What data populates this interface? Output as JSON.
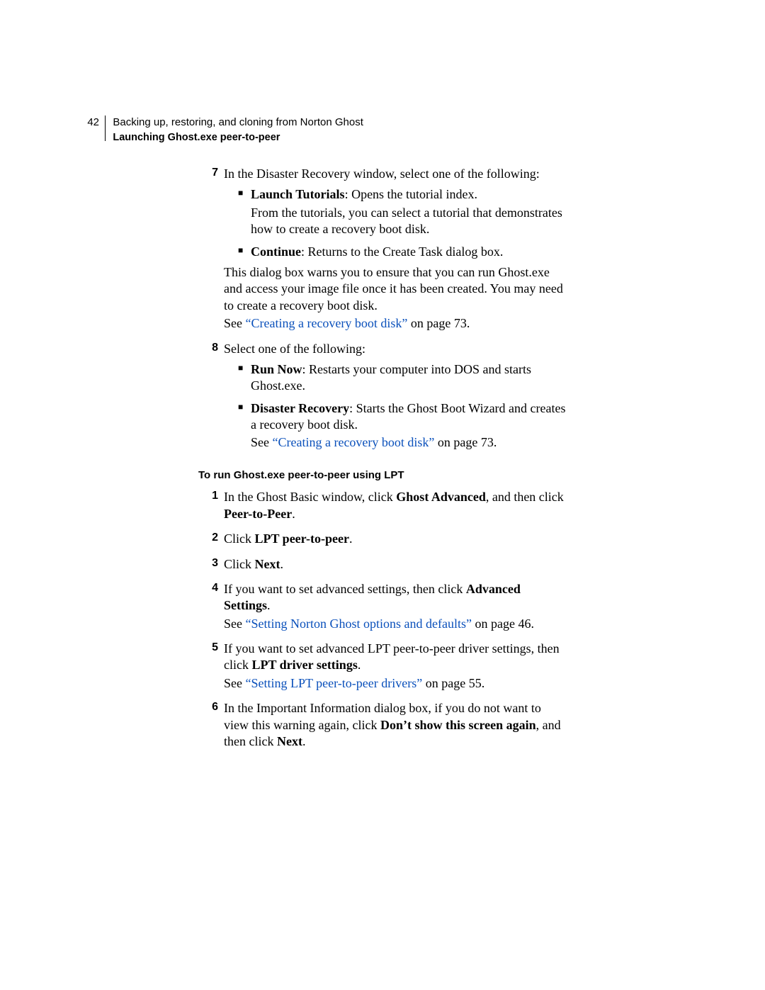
{
  "header": {
    "page_number": "42",
    "chapter": "Backing up, restoring, and cloning from Norton Ghost",
    "section": "Launching Ghost.exe peer-to-peer"
  },
  "step7": {
    "num": "7",
    "intro": "In the Disaster Recovery window, select one of the following:",
    "b1_bold": "Launch Tutorials",
    "b1_rest": ": Opens the tutorial index.",
    "b1_cont": "From the tutorials, you can select a tutorial that demonstrates how to create a recovery boot disk.",
    "b2_bold": "Continue",
    "b2_rest": ": Returns to the Create Task dialog box.",
    "after1": "This dialog box warns you to ensure that you can run Ghost.exe and access your image file once it has been created. You may need to create a recovery boot disk.",
    "see_pre": "See ",
    "see_link": "“Creating a recovery boot disk”",
    "see_post": " on page 73."
  },
  "step8": {
    "num": "8",
    "intro": "Select one of the following:",
    "b1_bold": "Run Now",
    "b1_rest": ": Restarts your computer into DOS and starts Ghost.exe.",
    "b2_bold": "Disaster Recovery",
    "b2_rest": ": Starts the Ghost Boot Wizard and creates a recovery boot disk.",
    "b2_see_pre": "See ",
    "b2_see_link": "“Creating a recovery boot disk”",
    "b2_see_post": " on page 73."
  },
  "heading2": "To run Ghost.exe peer-to-peer using LPT",
  "lpt1": {
    "num": "1",
    "pre": "In the Ghost Basic window, click ",
    "b1": "Ghost Advanced",
    "mid": ", and then click ",
    "b2": "Peer-to-Peer",
    "post": "."
  },
  "lpt2": {
    "num": "2",
    "pre": "Click ",
    "b1": "LPT peer-to-peer",
    "post": "."
  },
  "lpt3": {
    "num": "3",
    "pre": "Click ",
    "b1": "Next",
    "post": "."
  },
  "lpt4": {
    "num": "4",
    "pre": "If you want to set advanced settings, then click ",
    "b1": "Advanced Settings",
    "post": ".",
    "see_pre": "See ",
    "see_link": "“Setting Norton Ghost options and defaults”",
    "see_post": " on page 46."
  },
  "lpt5": {
    "num": "5",
    "pre": "If you want to set advanced LPT peer-to-peer driver settings, then click ",
    "b1": "LPT driver settings",
    "post": ".",
    "see_pre": "See ",
    "see_link": "“Setting LPT peer-to-peer drivers”",
    "see_post": " on page 55."
  },
  "lpt6": {
    "num": "6",
    "pre": "In the Important Information dialog box, if you do not want to view this warning again, click ",
    "b1": "Don’t show this screen again",
    "mid": ", and then click ",
    "b2": "Next",
    "post": "."
  }
}
